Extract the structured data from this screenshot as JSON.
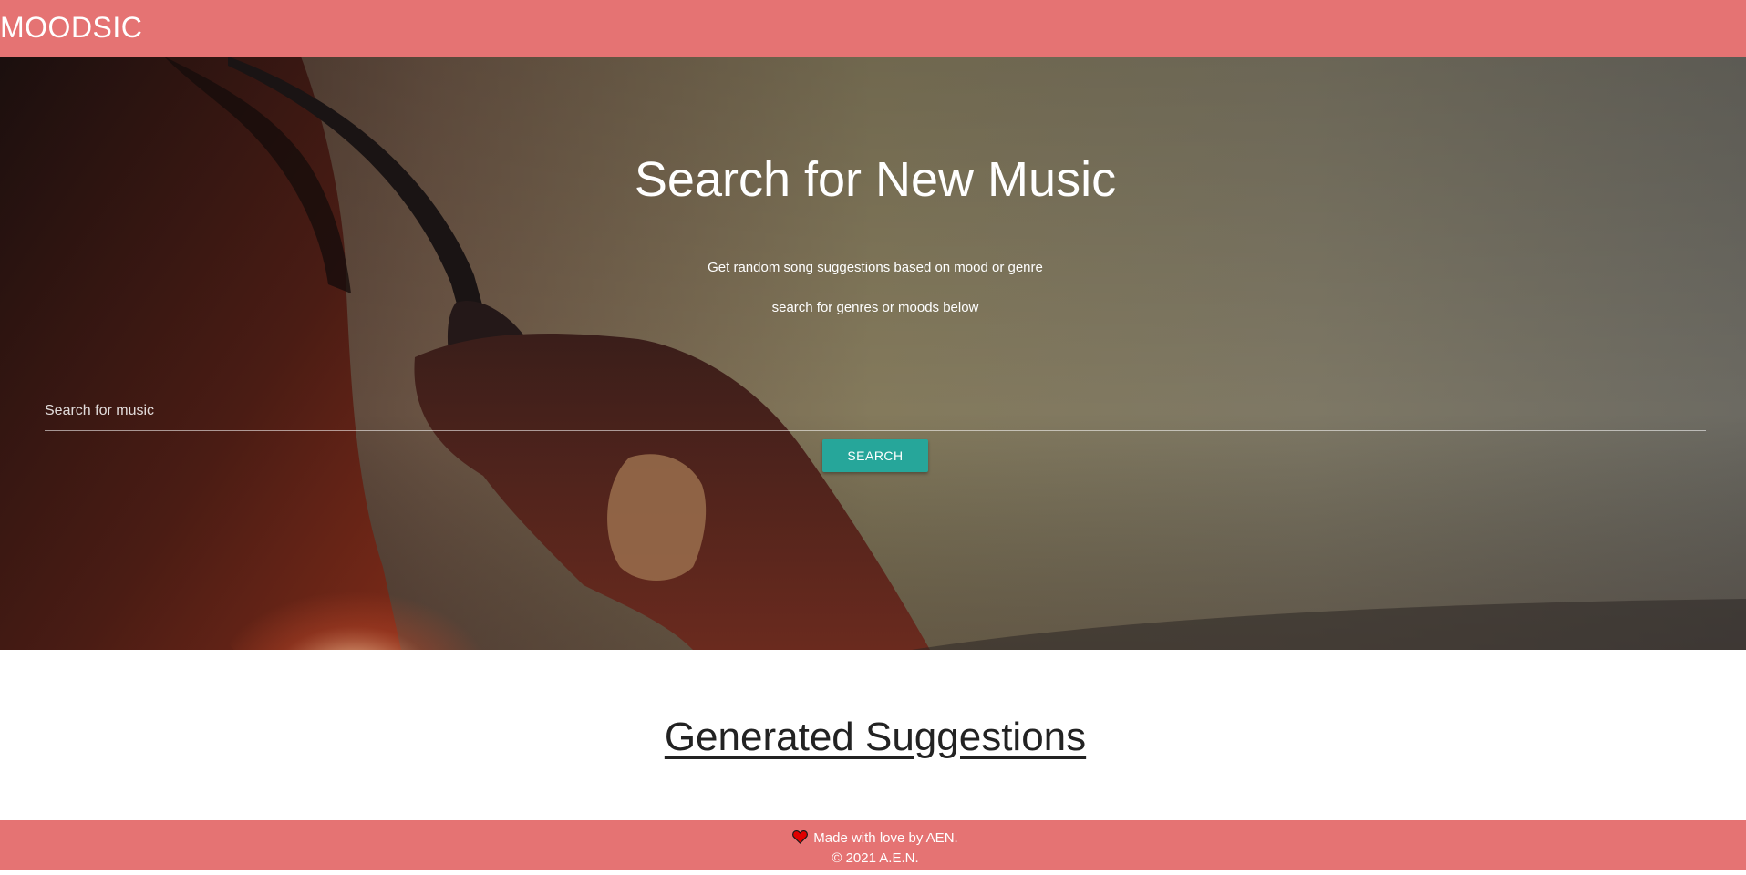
{
  "navbar": {
    "brand": "MOODSIC"
  },
  "hero": {
    "title": "Search for New Music",
    "subtitle_line1": "Get random song suggestions based on mood or genre",
    "subtitle_line2": "search for genres or moods below",
    "search": {
      "placeholder": "Search for music",
      "value": ""
    },
    "search_button_label": "SEARCH"
  },
  "suggestions": {
    "title": "Generated Suggestions"
  },
  "footer": {
    "heart_icon": "heart-icon",
    "made_with": "Made with love by AEN.",
    "copyright": "© 2021 A.E.N."
  },
  "colors": {
    "brand": "#e57373",
    "button": "#26a69a",
    "heart": "#e00000"
  }
}
